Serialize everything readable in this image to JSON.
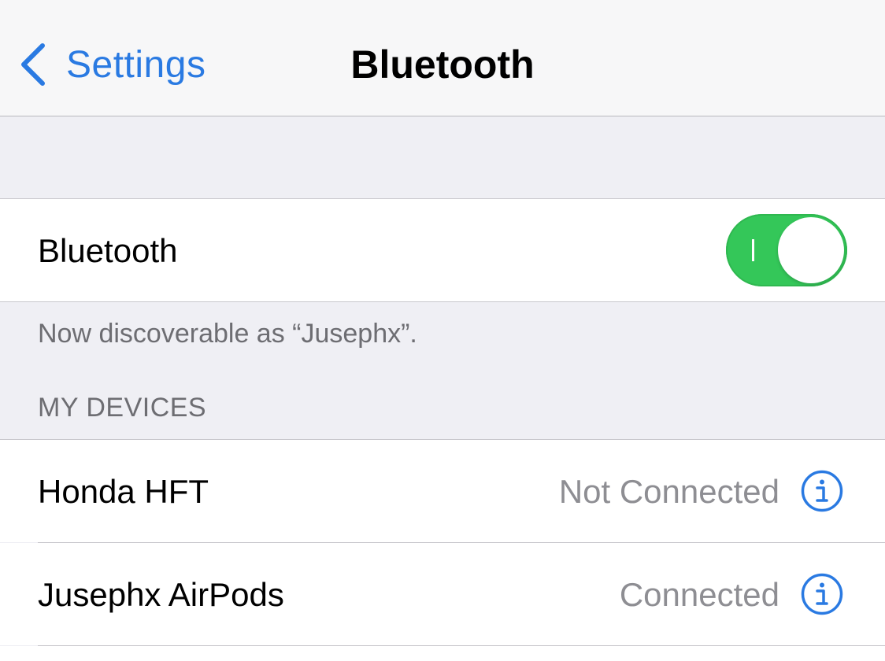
{
  "nav": {
    "back_label": "Settings",
    "title": "Bluetooth"
  },
  "bluetooth_row": {
    "label": "Bluetooth",
    "toggle_on": true
  },
  "discoverable_text": "Now discoverable as “Jusephx”.",
  "my_devices": {
    "header": "MY DEVICES",
    "devices": [
      {
        "name": "Honda HFT",
        "status": "Not Connected"
      },
      {
        "name": "Jusephx AirPods",
        "status": "Connected"
      }
    ]
  },
  "colors": {
    "accent": "#2a7ae2",
    "toggle_on": "#34c759",
    "background": "#efeff4",
    "secondary_text": "#8e8e93"
  },
  "icons": {
    "back": "chevron-left-icon",
    "info": "info-circle-icon"
  }
}
